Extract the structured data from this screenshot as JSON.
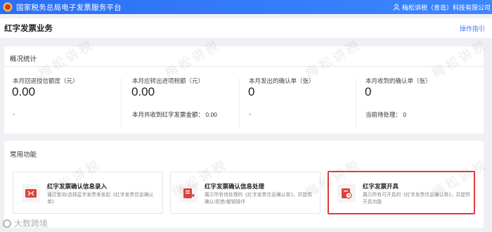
{
  "header": {
    "app_title": "国家税务总局电子发票服务平台",
    "user_label": "梅松讲税（青岛）科技有限公司"
  },
  "page": {
    "title": "红字发票业务",
    "op_guide": "操作指引"
  },
  "overview": {
    "title": "概况统计",
    "stats": [
      {
        "label": "本月回退授信额度（元）",
        "value": "0.00",
        "sub": "-"
      },
      {
        "label": "本月应转出进项税额（元）",
        "value": "0.00",
        "sub": "本月共收到红字发票金额：  0.00"
      },
      {
        "label": "本月发出的确认单（张）",
        "value": "0",
        "sub": "-"
      },
      {
        "label": "本月收到的确认单（张）",
        "value": "0",
        "sub": "当前待处理：  0"
      }
    ]
  },
  "functions": {
    "title": "常用功能",
    "cards": [
      {
        "title": "红字发票确认信息录入",
        "desc": "通过查询/选择蓝字发票来发起《红字发票信息确认单》",
        "icon": "invoice-entry-icon"
      },
      {
        "title": "红字发票确认信息处理",
        "desc": "展示所有待处理的《红字发票信息确认单》，并提供确认/拒绝/撤销操作",
        "icon": "invoice-process-icon"
      },
      {
        "title": "红字发票开具",
        "desc": "展示所有可开具的《红字发票信息确认单》，并提供开具功能",
        "icon": "invoice-issue-icon"
      }
    ]
  },
  "watermark_text": "梅松讲税",
  "footer_logo": "大数跨境",
  "colors": {
    "topbar": "#2b6ff5",
    "accent": "#3d7bff",
    "highlight_border": "#e03a3a",
    "icon_red": "#e0403a"
  }
}
